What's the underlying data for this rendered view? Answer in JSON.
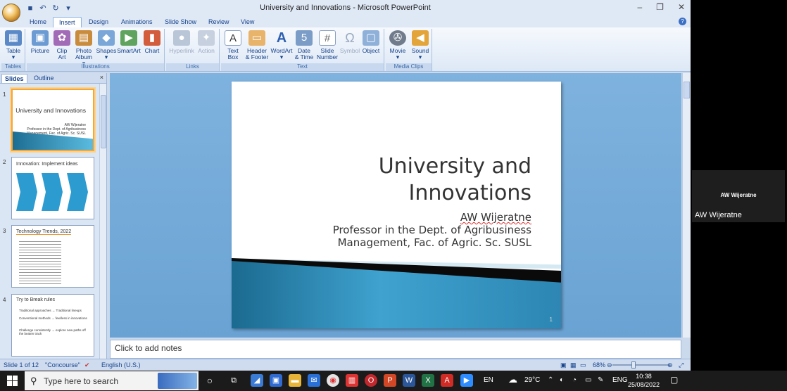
{
  "window": {
    "title": "University and Innovations - Microsoft PowerPoint",
    "minimize": "–",
    "restore": "❐",
    "close": "✕"
  },
  "tabs": [
    "Home",
    "Insert",
    "Design",
    "Animations",
    "Slide Show",
    "Review",
    "View"
  ],
  "active_tab": "Insert",
  "ribbon": {
    "groups": [
      "Tables",
      "Illustrations",
      "Links",
      "Text",
      "Media Clips"
    ],
    "buttons": {
      "table": "Table",
      "picture": "Picture",
      "clip_art_1": "Clip",
      "clip_art_2": "Art",
      "photo_album_1": "Photo",
      "photo_album_2": "Album ▾",
      "shapes": "Shapes",
      "smartart": "SmartArt",
      "chart": "Chart",
      "hyperlink": "Hyperlink",
      "action": "Action",
      "text_box_1": "Text",
      "text_box_2": "Box",
      "header_footer_1": "Header",
      "header_footer_2": "& Footer",
      "wordart": "WordArt",
      "date_time_1": "Date",
      "date_time_2": "& Time",
      "slide_number_1": "Slide",
      "slide_number_2": "Number",
      "symbol": "Symbol",
      "object": "Object",
      "movie": "Movie",
      "sound": "Sound"
    }
  },
  "left_pane": {
    "tabs": [
      "Slides",
      "Outline"
    ],
    "active": "Slides",
    "close": "×",
    "thumbs": [
      {
        "num": "1",
        "title": "University and Innovations",
        "lines": [
          "AW Wijeratne",
          "Professor in the Dept. of Agribusiness",
          "Management, Fac. of Agric. Sc. SUSL"
        ]
      },
      {
        "num": "2",
        "title": "Innovation: Implement ideas"
      },
      {
        "num": "3",
        "title": "Technology Trends, 2022"
      },
      {
        "num": "4",
        "title": "Try to Break rules",
        "lines": [
          "Traditional approaches → Traditional lineups",
          "Conventional methods → few/less in innovations",
          "Challenge consistently → explore new paths off the beaten track"
        ]
      }
    ]
  },
  "slide": {
    "title_line1": "University and",
    "title_line2": "Innovations",
    "author": "AW Wijeratne",
    "affil_line1": "Professor in the Dept. of Agribusiness",
    "affil_line2": "Management, Fac. of Agric. Sc. SUSL",
    "number": "1"
  },
  "notes_placeholder": "Click to add notes",
  "status": {
    "slide": "Slide 1 of 12",
    "theme": "\"Concourse\"",
    "language": "English (U.S.)",
    "zoom": "68%"
  },
  "video": {
    "name_tile": "AW Wijeratne",
    "label": "AW Wijeratne"
  },
  "taskbar": {
    "search_placeholder": "Type here to search",
    "lang": "EN",
    "weather": "29°C",
    "input_lang": "ENG",
    "time": "10:38",
    "date": "25/08/2022"
  }
}
